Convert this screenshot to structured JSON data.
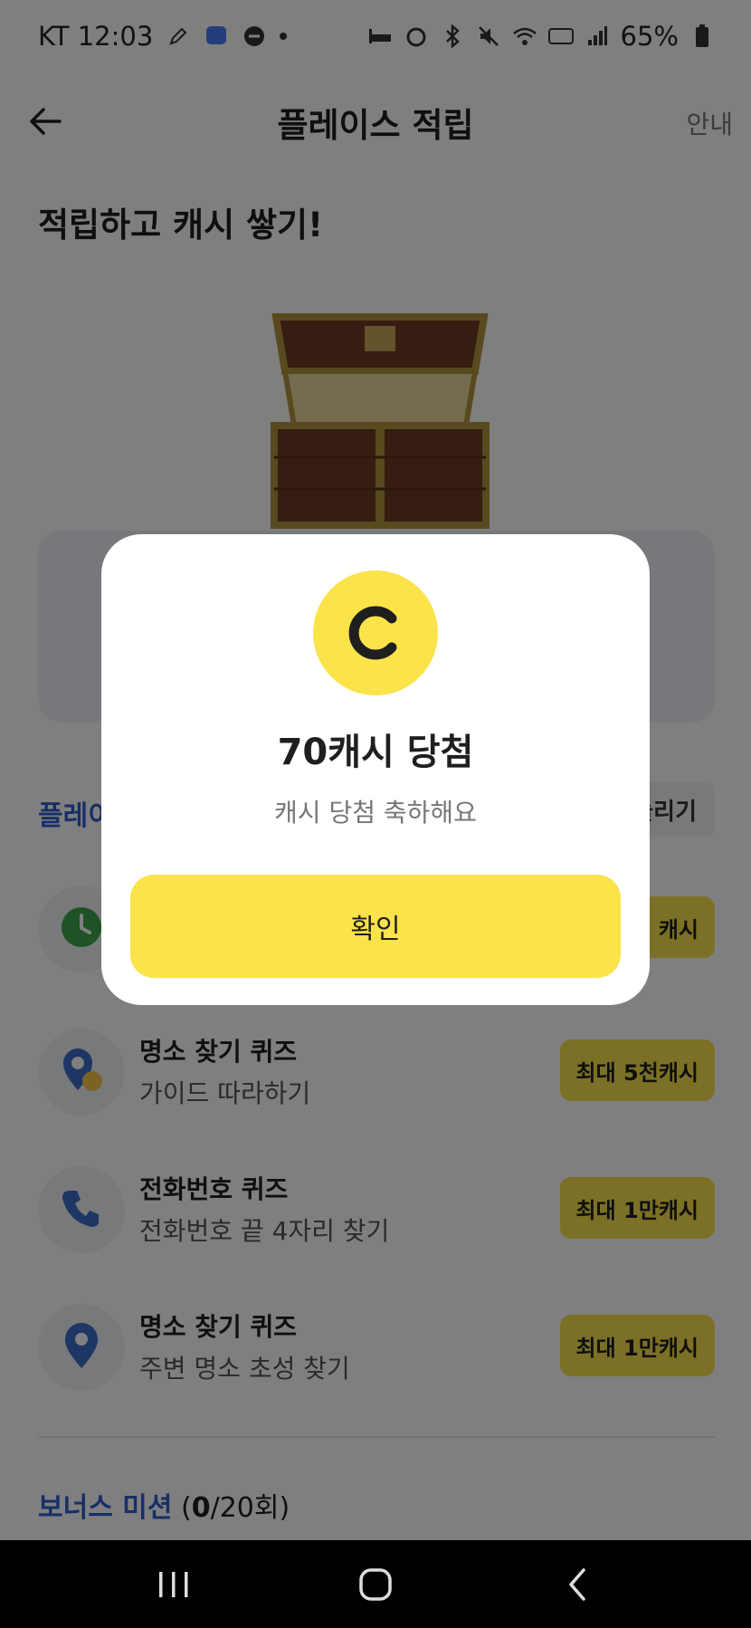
{
  "status_bar": {
    "carrier_time": "KT 12:03",
    "battery": "65%"
  },
  "app_bar": {
    "title": "플레이스 적립",
    "guide_label": "안내"
  },
  "headline": "적립하고 캐시 쌓기!",
  "section": {
    "title_partial": "플레이",
    "button_partial": "늘리기"
  },
  "missions": [
    {
      "reward": "캐시"
    },
    {
      "title": "명소 찾기 퀴즈",
      "subtitle": "가이드 따라하기",
      "reward": "최대 5천캐시"
    },
    {
      "title": "전화번호 퀴즈",
      "subtitle": "전화번호 끝 4자리 찾기",
      "reward": "최대 1만캐시"
    },
    {
      "title": "명소 찾기 퀴즈",
      "subtitle": "주변 명소 초성 찾기",
      "reward": "최대 1만캐시"
    }
  ],
  "bonus": {
    "title": "보너스 미션",
    "count_current": "0",
    "count_rest": "/20회)",
    "count_open": "("
  },
  "modal": {
    "headline": "70캐시 당첨",
    "description": "캐시 당첨 축하해요",
    "confirm_label": "확인"
  },
  "colors": {
    "accent_yellow": "#fbe34a",
    "accent_blue": "#2f5fcf",
    "overlay": "rgba(0,0,0,0.5)"
  }
}
